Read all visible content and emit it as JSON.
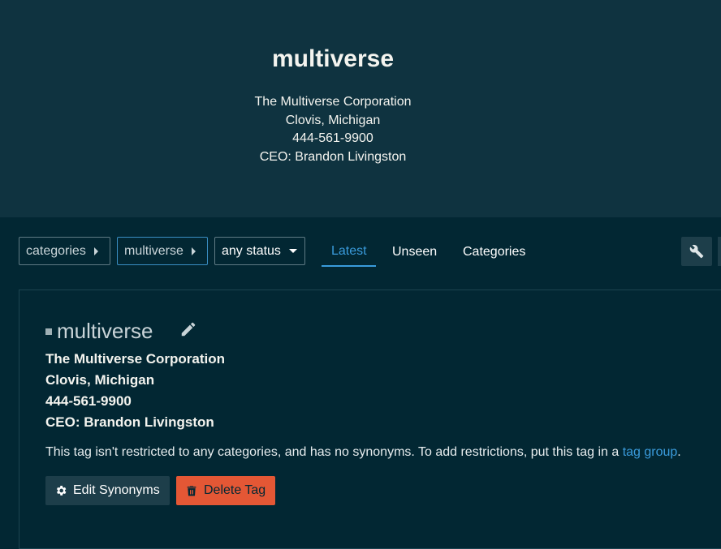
{
  "hero": {
    "title": "multiverse",
    "lines": [
      "The Multiverse Corporation",
      "Clovis, Michigan",
      "444-561-9900",
      "CEO: Brandon Livingston"
    ]
  },
  "navigation": {
    "breadcrumbs": [
      {
        "label": "categories",
        "icon": "caret-right-icon"
      },
      {
        "label": "multiverse",
        "icon": "caret-right-icon"
      }
    ],
    "status_filter": {
      "selected": "any status",
      "icon": "caret-down-icon"
    },
    "tabs": [
      {
        "label": "Latest",
        "active": true
      },
      {
        "label": "Unseen",
        "active": false
      },
      {
        "label": "Categories",
        "active": false
      }
    ],
    "admin_icon": "wrench-icon"
  },
  "tag_info": {
    "name": "multiverse",
    "edit_icon": "pencil-icon",
    "description": [
      "The Multiverse Corporation",
      "Clovis, Michigan",
      "444-561-9900",
      "CEO: Brandon Livingston"
    ],
    "note_text": "This tag isn't restricted to any categories, and has no synonyms. To add restrictions, put this tag in a",
    "note_link": "tag group",
    "note_end": ".",
    "buttons": {
      "edit_synonyms": {
        "label": "Edit Synonyms",
        "icon": "gear-icon"
      },
      "delete_tag": {
        "label": "Delete Tag",
        "icon": "trash-icon"
      }
    }
  },
  "colors": {
    "background": "#022733",
    "hero_background": "#0f3340",
    "accent": "#3a9bdc",
    "danger": "#e45735",
    "secondary_button": "#1d3e4a"
  }
}
